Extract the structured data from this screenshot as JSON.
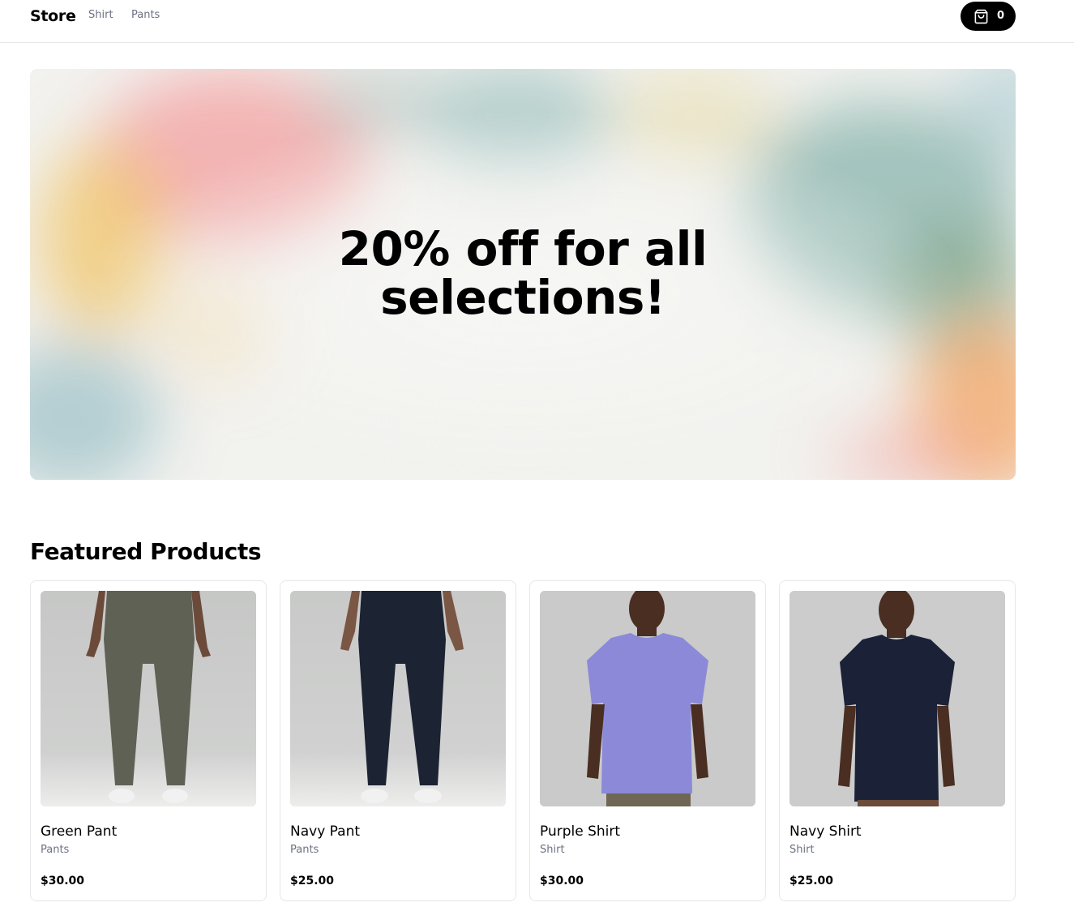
{
  "header": {
    "brand": "Store",
    "nav": [
      {
        "label": "Shirt"
      },
      {
        "label": "Pants"
      }
    ],
    "cart": {
      "count": "0",
      "icon": "shopping-bag-icon"
    }
  },
  "hero": {
    "line1": "20% off for all",
    "line2": "selections!"
  },
  "featured": {
    "title": "Featured Products",
    "products": [
      {
        "name": "Green Pant",
        "category": "Pants",
        "price": "$30.00",
        "color": "#5e6154"
      },
      {
        "name": "Navy Pant",
        "category": "Pants",
        "price": "$25.00",
        "color": "#1c2333"
      },
      {
        "name": "Purple Shirt",
        "category": "Shirt",
        "price": "$30.00",
        "color": "#8b89d8"
      },
      {
        "name": "Navy Shirt",
        "category": "Shirt",
        "price": "$25.00",
        "color": "#1b2238"
      }
    ]
  },
  "colors": {
    "accent": "#000000",
    "muted_text": "#6b7280",
    "border": "#e5e7eb"
  }
}
